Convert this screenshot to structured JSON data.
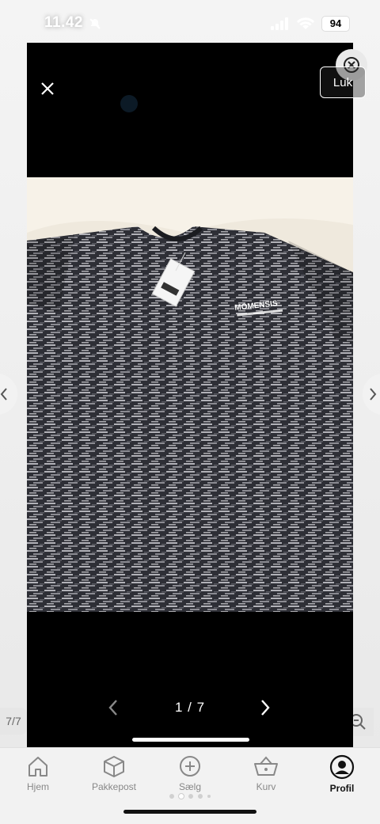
{
  "status": {
    "time": "11.42",
    "battery": "94"
  },
  "viewer": {
    "close_label": "Luk",
    "pager": "1 / 7",
    "side_count": "7/7",
    "brand_on_shirt": "MOMENSIS"
  },
  "tabs": [
    {
      "label": "Hjem",
      "icon": "home-icon"
    },
    {
      "label": "Pakkepost",
      "icon": "package-icon"
    },
    {
      "label": "Sælg",
      "icon": "plus-circle-icon"
    },
    {
      "label": "Kurv",
      "icon": "basket-icon"
    },
    {
      "label": "Profil",
      "icon": "profile-icon",
      "active": true
    }
  ],
  "colors": {
    "accent": "#111111",
    "inactive": "#888888",
    "viewer_bg": "#000000"
  }
}
